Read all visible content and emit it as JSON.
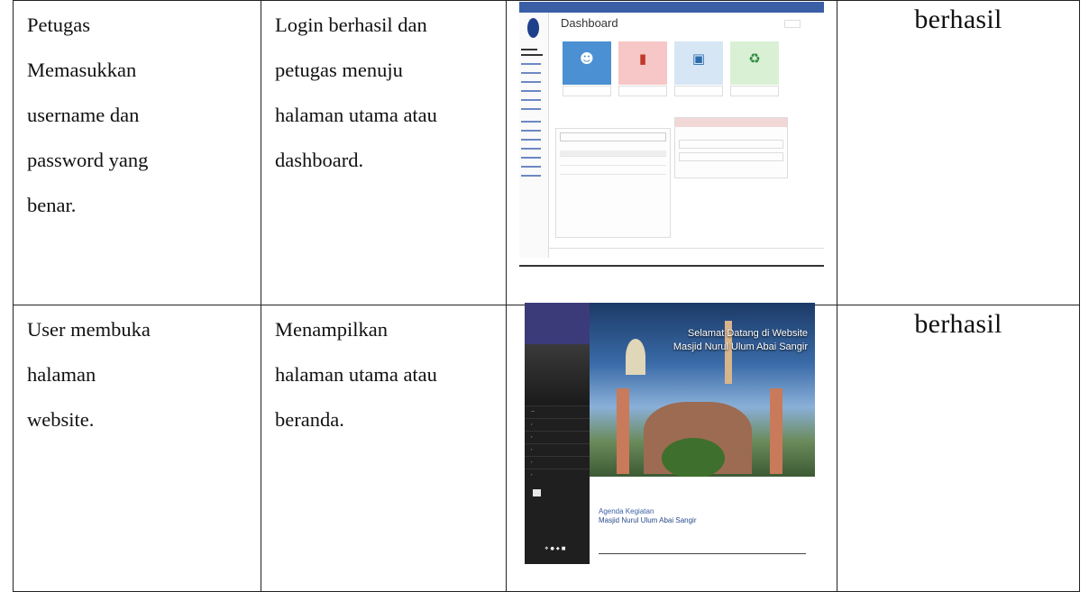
{
  "rows": [
    {
      "action_lines": [
        "Petugas",
        "Memasukkan",
        "username dan",
        "password yang",
        "benar."
      ],
      "expected_lines": [
        "Login berhasil dan",
        "petugas menuju",
        "halaman utama atau",
        "dashboard."
      ],
      "result": "berhasil",
      "screenshot": {
        "title": "Dashboard",
        "cards": [
          {
            "color": "#4a90d2",
            "icon": "user-icon"
          },
          {
            "color": "#f7c6c6",
            "icon": "signal-bars-icon"
          },
          {
            "color": "#d6e6f5",
            "icon": "money-icon"
          },
          {
            "color": "#d9f0d4",
            "icon": "recycle-icon"
          }
        ]
      }
    },
    {
      "action_lines": [
        "User membuka",
        "halaman",
        "website."
      ],
      "expected_lines": [
        "Menampilkan",
        "halaman utama atau",
        "beranda."
      ],
      "result": "berhasil",
      "screenshot": {
        "hero_line1": "Selamat Datang di Website",
        "hero_line2": "Masjid Nurul Ulum Abai Sangir",
        "agenda_line1": "Agenda Kegiatan",
        "agenda_line2": "Masjid Nurul Ulum Abai Sangir"
      }
    }
  ]
}
